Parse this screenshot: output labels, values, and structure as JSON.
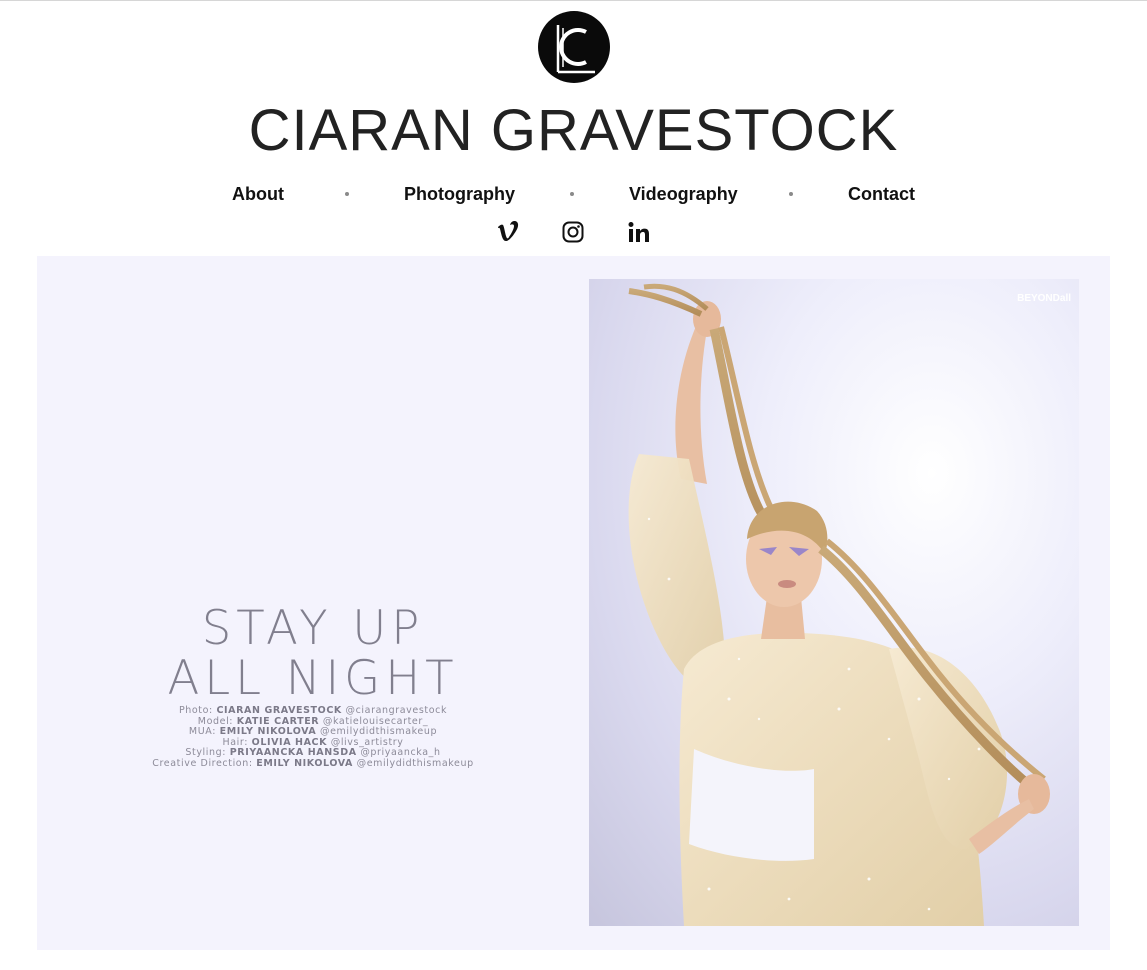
{
  "site": {
    "logo_icon": "ciaran-gravestock-monogram-logo",
    "title": "CIARAN GRAVESTOCK"
  },
  "nav": {
    "items": [
      {
        "label": "About"
      },
      {
        "label": "Photography"
      },
      {
        "label": "Videography"
      },
      {
        "label": "Contact"
      }
    ]
  },
  "social": {
    "items": [
      {
        "icon": "vimeo-icon"
      },
      {
        "icon": "instagram-icon"
      },
      {
        "icon": "linkedin-icon"
      }
    ]
  },
  "hero": {
    "headline_line1": "STAY UP",
    "headline_line2": "ALL NIGHT",
    "credits": [
      {
        "role": "Photo:",
        "name": "CIARAN GRAVESTOCK",
        "handle": "@ciarangravestock"
      },
      {
        "role": "Model:",
        "name": "KATIE CARTER",
        "handle": "@katielouisecarter_"
      },
      {
        "role": "MUA:",
        "name": "EMILY NIKOLOVA",
        "handle": "@emilydidthismakeup"
      },
      {
        "role": "Hair:",
        "name": "OLIVIA HACK",
        "handle": "@livs_artistry"
      },
      {
        "role": "Styling:",
        "name": "PRIYAANCKA HANSDA",
        "handle": "@priyaancka_h"
      },
      {
        "role": "Creative Direction:",
        "name": "EMILY NIKOLOVA",
        "handle": "@emilydidthismakeup"
      }
    ],
    "photo": {
      "brand_mark": "BEYONDall"
    },
    "background_color": "#f4f3fd"
  }
}
